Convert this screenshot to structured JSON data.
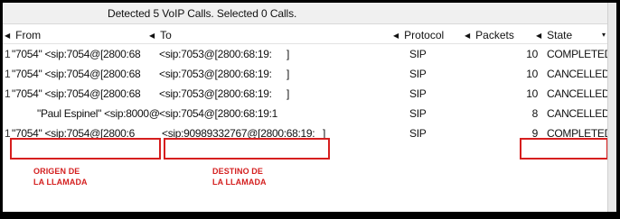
{
  "status": {
    "text": "Detected 5 VoIP Calls. Selected 0 Calls."
  },
  "columns": {
    "from": "From",
    "to": "To",
    "protocol": "Protocol",
    "packets": "Packets",
    "state": "State"
  },
  "rows": [
    {
      "idx": "1",
      "from": "\"7054\" <sip:7054@[2800:68",
      "to": "<sip:7053@[2800:68:19:",
      "to_end": "]",
      "protocol": "SIP",
      "packets": "10",
      "state": "COMPLETED"
    },
    {
      "idx": "1",
      "from": "\"7054\" <sip:7054@[2800:68",
      "to": "<sip:7053@[2800:68:19:",
      "to_end": "]",
      "protocol": "SIP",
      "packets": "10",
      "state": "CANCELLED"
    },
    {
      "idx": "1",
      "from": "\"7054\" <sip:7054@[2800:68",
      "to": "<sip:7053@[2800:68:19:",
      "to_end": "]",
      "protocol": "SIP",
      "packets": "10",
      "state": "CANCELLED"
    },
    {
      "idx": "",
      "from": "\"Paul Espinel\" <sip:8000@",
      "to": "<sip:7054@[2800:68:19:1",
      "to_end": "",
      "protocol": "SIP",
      "packets": "8",
      "state": "CANCELLED"
    },
    {
      "idx": "1",
      "from": "\"7054\" <sip:7054@[2800:6",
      "to": "<sip:90989332767@[2800:68:19:",
      "to_end": "]",
      "protocol": "SIP",
      "packets": "9",
      "state": "COMPLETED"
    }
  ],
  "annotations": {
    "origin": "ORIGEN DE\nLA LLAMADA",
    "destination": "DESTINO DE\nLA LLAMADA"
  },
  "colors": {
    "highlight": "#d61e1e",
    "annotation_text": "#d42020"
  }
}
